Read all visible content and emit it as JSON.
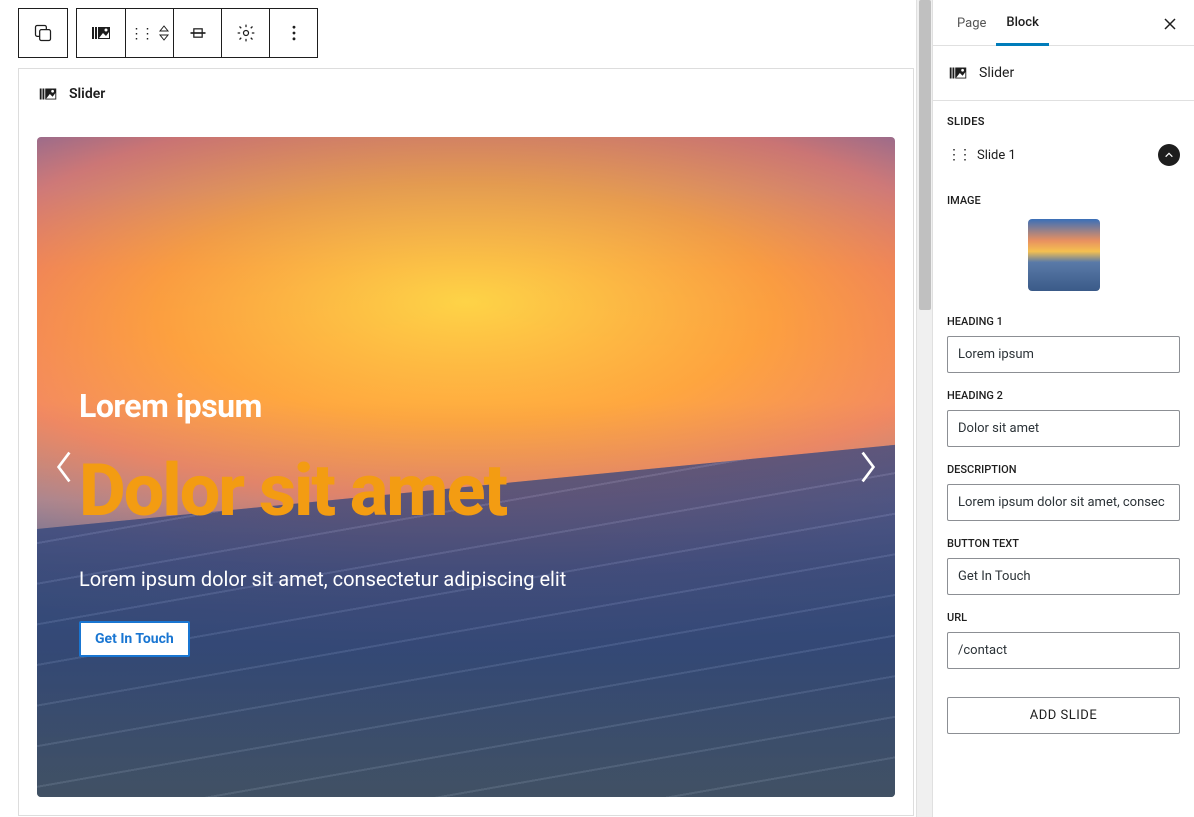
{
  "toolbar": {
    "blockName": "Slider"
  },
  "slider_preview": {
    "heading1": "Lorem ipsum",
    "heading2": "Dolor sit amet",
    "description": "Lorem ipsum dolor sit amet, consectetur adipiscing elit",
    "button": "Get In Touch"
  },
  "sidebar": {
    "tabs": {
      "page": "Page",
      "block": "Block"
    },
    "blockName": "Slider",
    "sections": {
      "slides_label": "SLIDES",
      "slide_item": "Slide 1",
      "image_label": "IMAGE",
      "heading1_label": "HEADING 1",
      "heading1_value": "Lorem ipsum",
      "heading2_label": "HEADING 2",
      "heading2_value": "Dolor sit amet",
      "description_label": "DESCRIPTION",
      "description_value": "Lorem ipsum dolor sit amet, consec",
      "button_text_label": "BUTTON TEXT",
      "button_text_value": "Get In Touch",
      "url_label": "URL",
      "url_value": "/contact",
      "add_slide": "ADD SLIDE"
    }
  }
}
